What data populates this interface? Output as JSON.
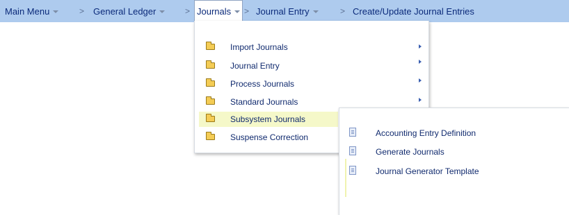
{
  "breadcrumb": {
    "main_menu": "Main Menu",
    "general_ledger": "General Ledger",
    "journals": "Journals",
    "journal_entry": "Journal Entry",
    "create_update": "Create/Update Journal Entries",
    "separator": ">"
  },
  "journals_menu": {
    "items": [
      {
        "label": "Import Journals",
        "has_submenu": true
      },
      {
        "label": "Journal Entry",
        "has_submenu": true
      },
      {
        "label": "Process Journals",
        "has_submenu": true
      },
      {
        "label": "Standard Journals",
        "has_submenu": true
      },
      {
        "label": "Subsystem Journals",
        "has_submenu": false,
        "highlighted": true
      },
      {
        "label": "Suspense Correction",
        "has_submenu": false
      }
    ]
  },
  "subsystem_menu": {
    "items": [
      {
        "label": "Accounting Entry Definition"
      },
      {
        "label": "Generate Journals"
      },
      {
        "label": "Journal Generator Template"
      }
    ]
  },
  "colors": {
    "bar": "#aecbee",
    "highlight": "#f5f8c9",
    "link": "#102a6e",
    "folder": "#f4cc55"
  }
}
